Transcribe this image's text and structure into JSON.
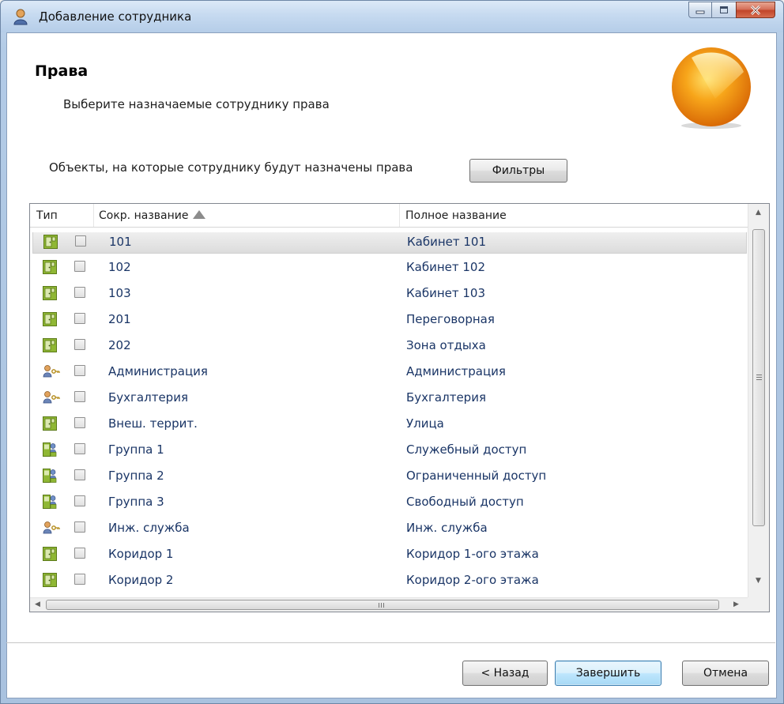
{
  "window": {
    "title": "Добавление сотрудника",
    "controls": [
      "minimize",
      "maximize",
      "close"
    ]
  },
  "header": {
    "title": "Права",
    "subtitle": "Выберите назначаемые сотруднику права"
  },
  "objects": {
    "label": "Объекты, на которые сотруднику будут назначены права",
    "filters_button": "Фильтры"
  },
  "grid": {
    "columns": {
      "type": "Тип",
      "short_name": "Сокр. название",
      "full_name": "Полное название"
    },
    "sort": {
      "column": "short_name",
      "direction": "ascending"
    },
    "rows": [
      {
        "icon": "door-icon",
        "short": "101",
        "full": "Кабинет 101",
        "checked": false,
        "selected": true
      },
      {
        "icon": "door-icon",
        "short": "102",
        "full": "Кабинет 102",
        "checked": false,
        "selected": false
      },
      {
        "icon": "door-icon",
        "short": "103",
        "full": "Кабинет 103",
        "checked": false,
        "selected": false
      },
      {
        "icon": "door-icon",
        "short": "201",
        "full": "Переговорная",
        "checked": false,
        "selected": false
      },
      {
        "icon": "door-icon",
        "short": "202",
        "full": "Зона отдыха",
        "checked": false,
        "selected": false
      },
      {
        "icon": "department-key-icon",
        "short": "Администрация",
        "full": "Администрация",
        "checked": false,
        "selected": false
      },
      {
        "icon": "department-key-icon",
        "short": "Бухгалтерия",
        "full": "Бухгалтерия",
        "checked": false,
        "selected": false
      },
      {
        "icon": "door-icon",
        "short": "Внеш. террит.",
        "full": "Улица",
        "checked": false,
        "selected": false
      },
      {
        "icon": "group-access-icon",
        "short": "Группа 1",
        "full": "Служебный доступ",
        "checked": false,
        "selected": false
      },
      {
        "icon": "group-access-icon",
        "short": "Группа 2",
        "full": "Ограниченный доступ",
        "checked": false,
        "selected": false
      },
      {
        "icon": "group-access-icon",
        "short": "Группа 3",
        "full": "Свободный доступ",
        "checked": false,
        "selected": false
      },
      {
        "icon": "department-key-icon",
        "short": "Инж. служба",
        "full": "Инж. служба",
        "checked": false,
        "selected": false
      },
      {
        "icon": "door-icon",
        "short": "Коридор 1",
        "full": "Коридор 1-ого этажа",
        "checked": false,
        "selected": false
      },
      {
        "icon": "door-icon",
        "short": "Коридор 2",
        "full": "Коридор 2-ого этажа",
        "checked": false,
        "selected": false
      }
    ]
  },
  "footer": {
    "back_button": "< Назад",
    "finish_button": "Завершить",
    "cancel_button": "Отмена"
  },
  "colors": {
    "link_text": "#1a3566",
    "door_icon": "#7aa62a",
    "orb": "#f39a12"
  }
}
